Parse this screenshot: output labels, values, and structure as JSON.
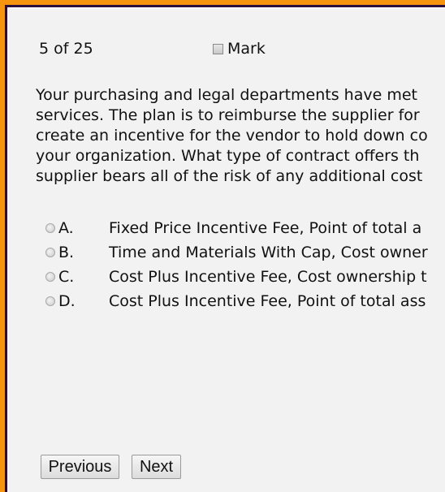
{
  "header": {
    "counter": "5 of 25",
    "mark_label": "Mark",
    "mark_checked": false
  },
  "question": {
    "lines": [
      "Your purchasing and legal departments have met",
      "services. The plan is to reimburse the supplier for",
      "create an incentive for the vendor to hold down co",
      "your organization. What type of contract offers th",
      "supplier bears all of the risk of any additional cost"
    ]
  },
  "options": [
    {
      "letter": "A.",
      "text": "Fixed Price Incentive Fee, Point of total a"
    },
    {
      "letter": "B.",
      "text": "Time and Materials With Cap, Cost owner"
    },
    {
      "letter": "C.",
      "text": "Cost Plus Incentive Fee, Cost ownership t"
    },
    {
      "letter": "D.",
      "text": "Cost Plus Incentive Fee, Point of total ass"
    }
  ],
  "nav": {
    "previous_label": "Previous",
    "next_label": "Next"
  }
}
